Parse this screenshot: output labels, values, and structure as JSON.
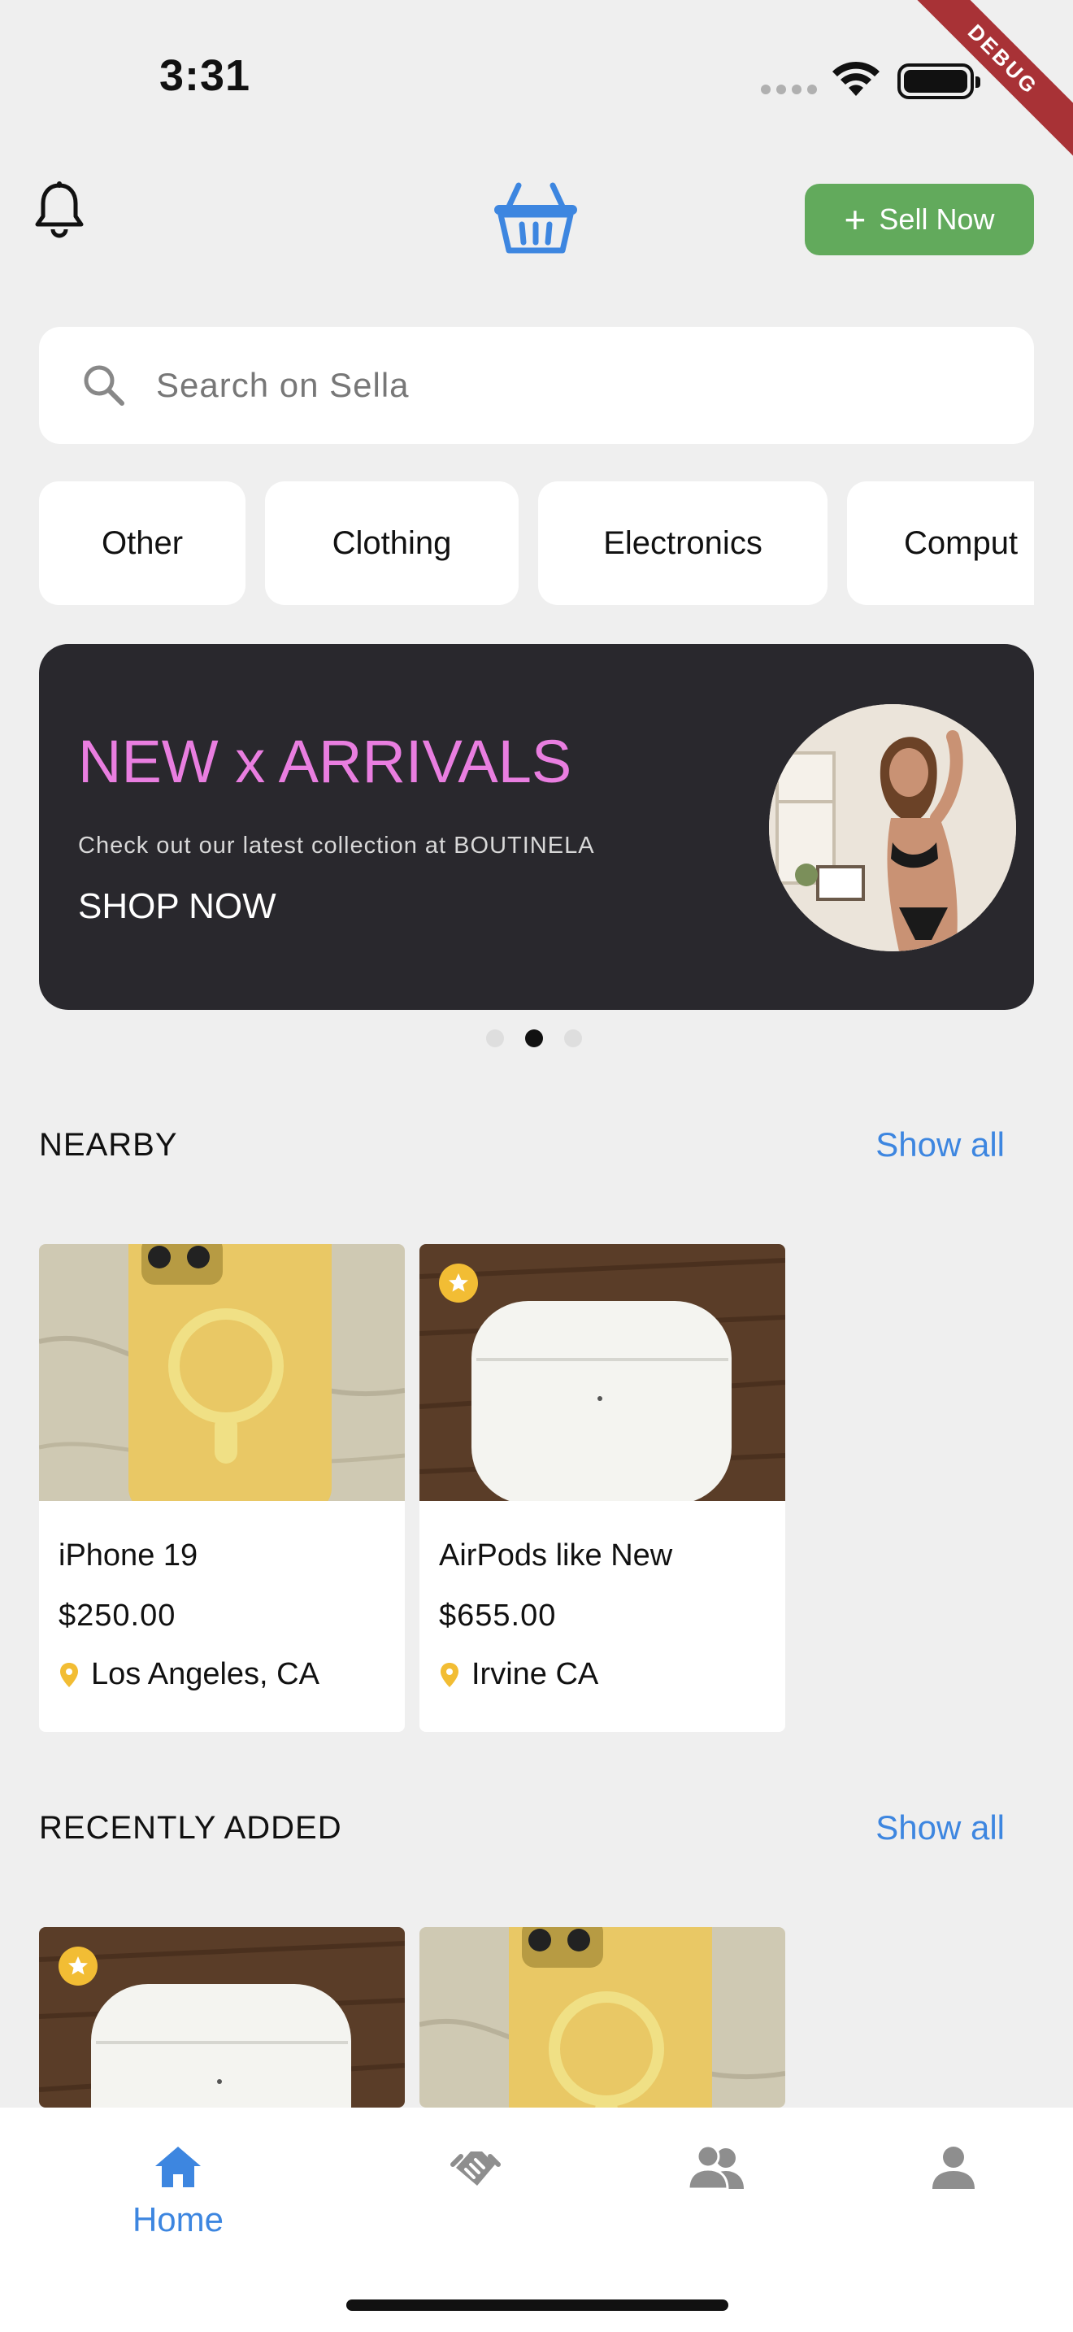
{
  "status_bar": {
    "time": "3:31",
    "debug_label": "DEBUG"
  },
  "header": {
    "sell_label": "Sell Now",
    "bell_icon": "bell-icon",
    "logo_icon": "basket-icon"
  },
  "search": {
    "placeholder": "Search on Sella"
  },
  "categories": [
    "Other",
    "Clothing",
    "Electronics",
    "Comput"
  ],
  "banner": {
    "title": "NEW x ARRIVALS",
    "subtitle": "Check out our latest collection at BOUTINELA",
    "cta": "SHOP NOW",
    "active_slide": 2,
    "slide_count": 3
  },
  "nearby": {
    "title": "NEARBY",
    "show_all": "Show all",
    "items": [
      {
        "title": "iPhone 19",
        "price": "$250.00",
        "location": "Los Angeles, CA",
        "featured": false
      },
      {
        "title": "AirPods like New",
        "price": "$655.00",
        "location": "Irvine CA",
        "featured": true
      }
    ]
  },
  "recent": {
    "title": "RECENTLY ADDED",
    "show_all": "Show all"
  },
  "nav": {
    "items": [
      {
        "label": "Home",
        "icon": "home-icon",
        "active": true
      },
      {
        "label": "",
        "icon": "handshake-icon",
        "active": false
      },
      {
        "label": "",
        "icon": "users-icon",
        "active": false
      },
      {
        "label": "",
        "icon": "user-icon",
        "active": false
      }
    ]
  },
  "colors": {
    "accent": "#3d86e0",
    "sell": "#62aa5c",
    "banner_bg": "#29282d",
    "banner_title": "#e97ee0",
    "star": "#f2bd34"
  }
}
